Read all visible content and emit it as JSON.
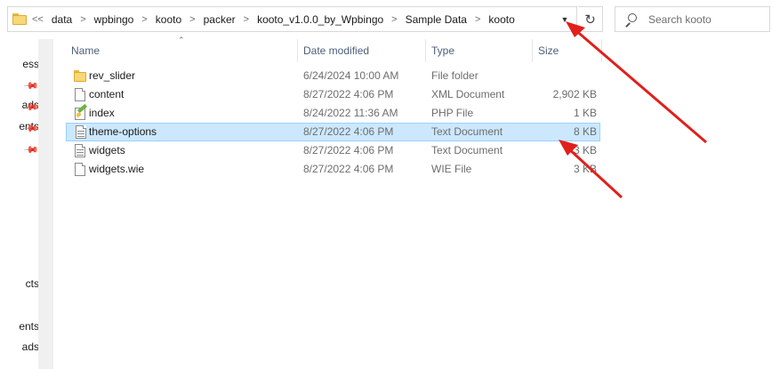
{
  "address_bar": {
    "overflow": "<<",
    "crumbs": [
      "data",
      "wpbingo",
      "kooto",
      "packer",
      "kooto_v1.0.0_by_Wpbingo",
      "Sample Data",
      "kooto"
    ],
    "separator": ">",
    "dropdown_icon": "chevron-down-icon",
    "refresh_icon": "refresh-icon"
  },
  "search": {
    "placeholder": "Search kooto"
  },
  "nav_pane": {
    "items": [
      {
        "label": "ess",
        "pinned": false
      },
      {
        "label": "ads",
        "pinned": true
      },
      {
        "label": "ents",
        "pinned": true
      },
      {
        "label": "cts",
        "pinned": false
      },
      {
        "label": "ents",
        "pinned": false
      },
      {
        "label": "ads",
        "pinned": false
      }
    ]
  },
  "columns": {
    "name": "Name",
    "date": "Date modified",
    "type": "Type",
    "size": "Size"
  },
  "files": [
    {
      "name": "rev_slider",
      "date": "6/24/2024 10:00 AM",
      "type": "File folder",
      "size": "",
      "icon": "folder-icon",
      "selected": false
    },
    {
      "name": "content",
      "date": "8/27/2022 4:06 PM",
      "type": "XML Document",
      "size": "2,902 KB",
      "icon": "xml-file-icon",
      "selected": false
    },
    {
      "name": "index",
      "date": "8/24/2022 11:36 AM",
      "type": "PHP File",
      "size": "1 KB",
      "icon": "php-file-icon",
      "selected": false
    },
    {
      "name": "theme-options",
      "date": "8/27/2022 4:06 PM",
      "type": "Text Document",
      "size": "8 KB",
      "icon": "text-file-icon",
      "selected": true
    },
    {
      "name": "widgets",
      "date": "8/27/2022 4:06 PM",
      "type": "Text Document",
      "size": "3 KB",
      "icon": "text-file-icon",
      "selected": false
    },
    {
      "name": "widgets.wie",
      "date": "8/27/2022 4:06 PM",
      "type": "WIE File",
      "size": "3 KB",
      "icon": "file-icon",
      "selected": false
    }
  ],
  "annotation_color": "#e0201c"
}
